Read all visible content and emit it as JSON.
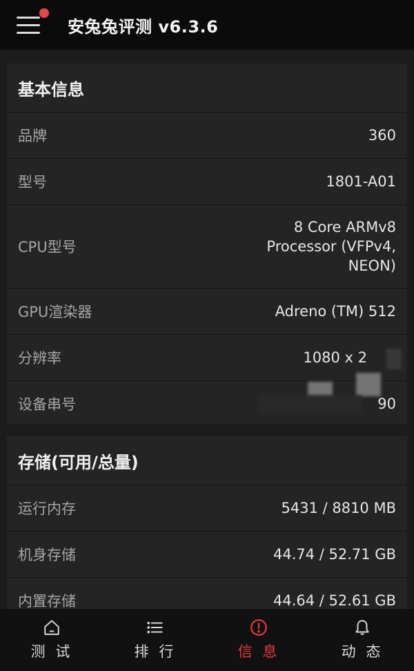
{
  "header": {
    "title": "安兔兔评测 v6.3.6"
  },
  "basic_info": {
    "title": "基本信息",
    "rows": [
      {
        "label": "品牌",
        "value": "360"
      },
      {
        "label": "型号",
        "value": "1801-A01"
      },
      {
        "label": "CPU型号",
        "value": "8 Core ARMv8\nProcessor (VFPv4,\nNEON)"
      },
      {
        "label": "GPU渲染器",
        "value": "Adreno (TM) 512"
      },
      {
        "label": "分辨率",
        "value": "1080 x 2"
      },
      {
        "label": "设备串号",
        "value": "90"
      }
    ]
  },
  "storage": {
    "title": "存储(可用/总量)",
    "rows": [
      {
        "label": "运行内存",
        "value": "5431 / 8810 MB"
      },
      {
        "label": "机身存储",
        "value": "44.74 / 52.71 GB"
      },
      {
        "label": "内置存储",
        "value": "44.64 / 52.61 GB"
      }
    ]
  },
  "bottom_nav": {
    "items": [
      {
        "label": "测 试",
        "icon": "home-icon",
        "active": false
      },
      {
        "label": "排 行",
        "icon": "list-icon",
        "active": false
      },
      {
        "label": "信 息",
        "icon": "info-alert-icon",
        "active": true
      },
      {
        "label": "动 态",
        "icon": "bell-icon",
        "active": false
      }
    ]
  },
  "colors": {
    "accent": "#e83a3f",
    "header_bg": "#0b0b0b",
    "card_bg": "#242424",
    "page_bg": "#1c1c1c"
  }
}
